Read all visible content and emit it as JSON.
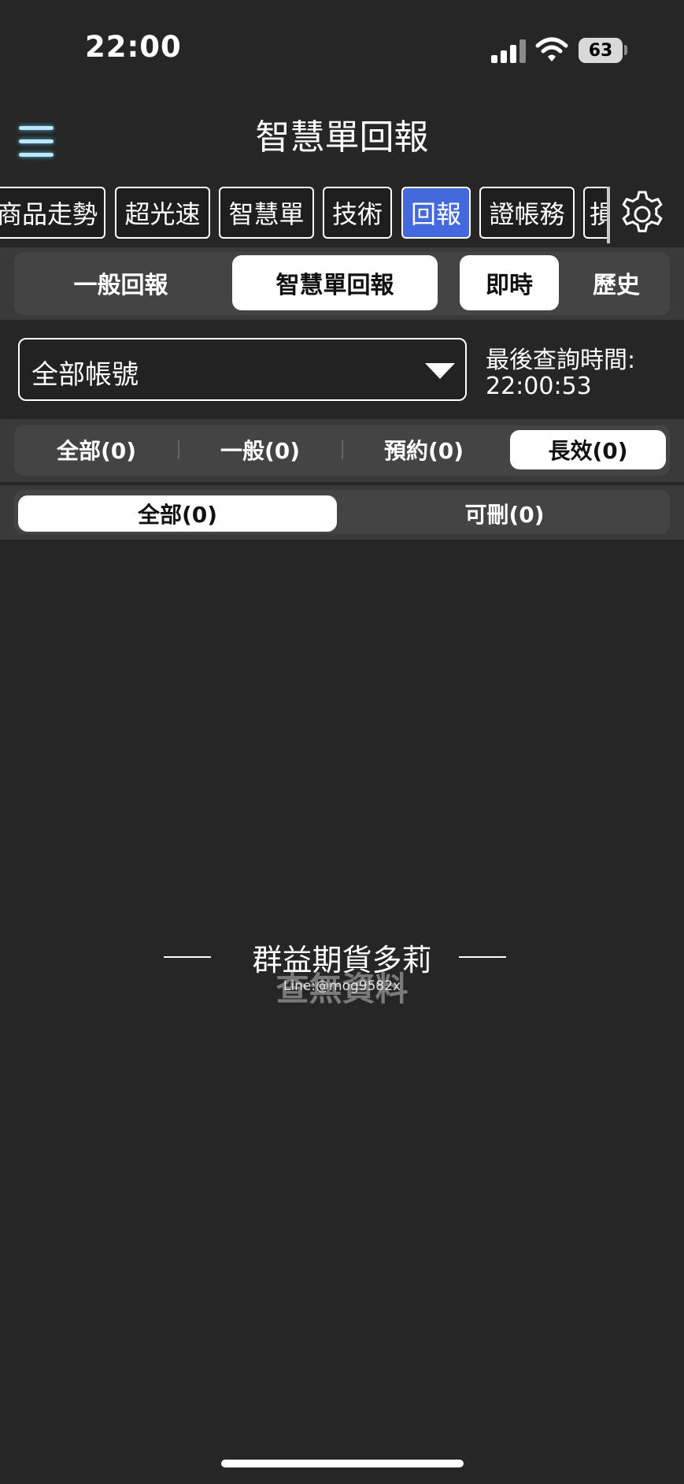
{
  "status_bar": {
    "time": "22:00",
    "battery": "63"
  },
  "header": {
    "title": "智慧單回報"
  },
  "function_tabs": [
    {
      "label": "商品走勢"
    },
    {
      "label": "超光速"
    },
    {
      "label": "智慧單"
    },
    {
      "label": "技術"
    },
    {
      "label": "回報",
      "active": true
    },
    {
      "label": "證帳務"
    },
    {
      "label": "損"
    }
  ],
  "report_type": {
    "general": "一般回報",
    "smart": "智慧單回報",
    "selected": "智慧單回報"
  },
  "time_mode": {
    "realtime": "即時",
    "history": "歷史",
    "selected": "即時"
  },
  "account": {
    "value": "全部帳號",
    "query_label": "最後查詢時間:",
    "query_time": "22:00:53"
  },
  "order_filter": {
    "all": "全部(0)",
    "general": "一般(0)",
    "reserved": "預約(0)",
    "long_term": "長效(0)",
    "selected": "長效(0)"
  },
  "sub_filter": {
    "all": "全部(0)",
    "deletable": "可刪(0)",
    "selected": "全部(0)"
  },
  "empty_state": {
    "watermark": "群益期貨多莉",
    "line_id": "Line:@mog9582x",
    "message": "查無資料"
  },
  "colors": {
    "background": "#262626",
    "active_tab": "#4469dc",
    "band": "#3a3a3a"
  }
}
